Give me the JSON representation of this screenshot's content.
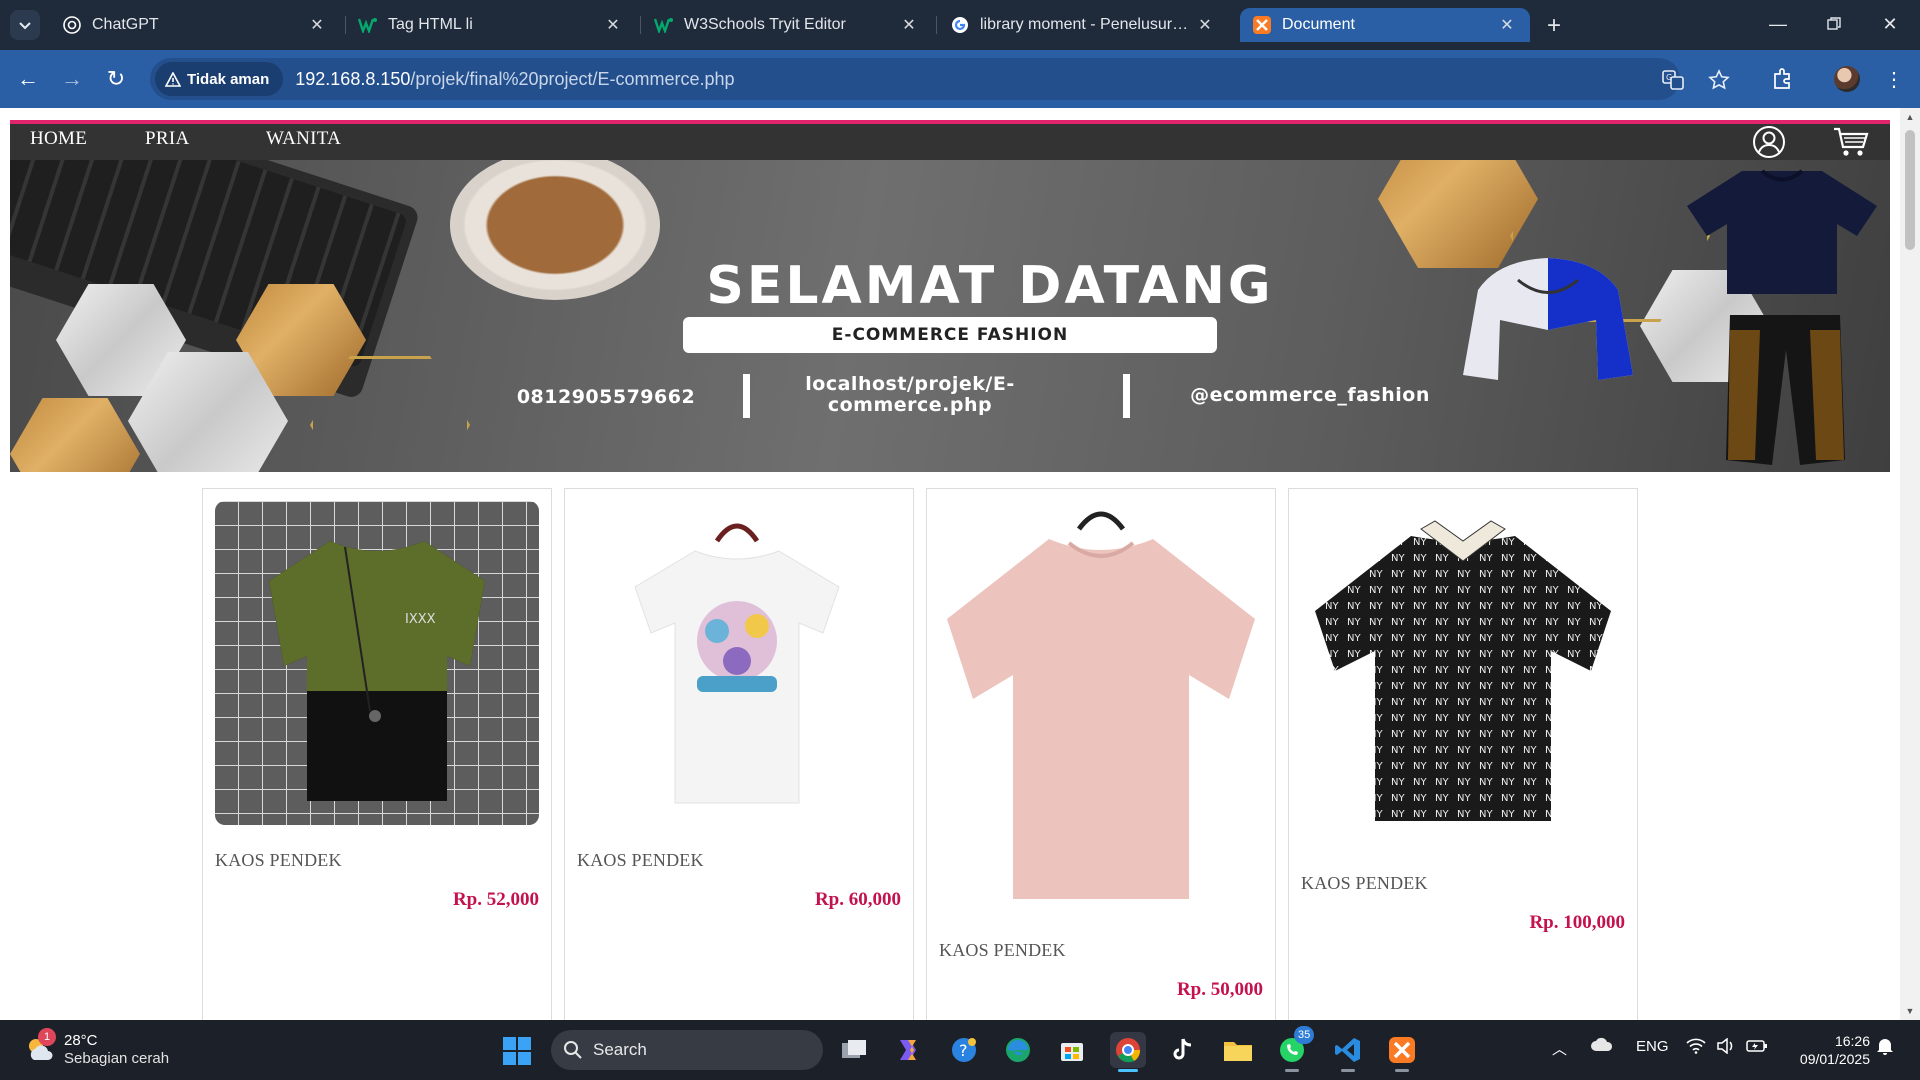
{
  "browser": {
    "tabs": [
      {
        "title": "ChatGPT",
        "icon": "chatgpt-icon"
      },
      {
        "title": "Tag HTML li",
        "icon": "w3schools-icon"
      },
      {
        "title": "W3Schools Tryit Editor",
        "icon": "w3schools-icon"
      },
      {
        "title": "library moment - Penelusuran G",
        "icon": "google-icon"
      },
      {
        "title": "Document",
        "icon": "xampp-icon",
        "active": true
      }
    ],
    "security_label": "Tidak aman",
    "url_host": "192.168.8.150",
    "url_path": "/projek/final%20project/E-commerce.php"
  },
  "site": {
    "nav": {
      "home": "HOME",
      "pria": "PRIA",
      "wanita": "WANITA"
    },
    "accent_color": "#e0256c",
    "hero": {
      "title": "SELAMAT DATANG",
      "subtitle": "E-COMMERCE FASHION",
      "phone": "0812905579662",
      "website_line1": "localhost/projek/E-",
      "website_line2": "commerce.php",
      "instagram": "@ecommerce_fashion"
    },
    "products": [
      {
        "name": "KAOS PENDEK",
        "price": "Rp. 52,000"
      },
      {
        "name": "KAOS PENDEK",
        "price": "Rp. 60,000"
      },
      {
        "name": "KAOS PENDEK",
        "price": "Rp. 50,000"
      },
      {
        "name": "KAOS PENDEK",
        "price": "Rp. 100,000"
      }
    ],
    "price_color": "#c4124f"
  },
  "taskbar": {
    "weather_badge": "1",
    "temperature": "28°C",
    "weather_desc": "Sebagian cerah",
    "search_placeholder": "Search",
    "whatsapp_badge": "35",
    "language": "ENG",
    "time": "16:26",
    "date": "09/01/2025"
  }
}
